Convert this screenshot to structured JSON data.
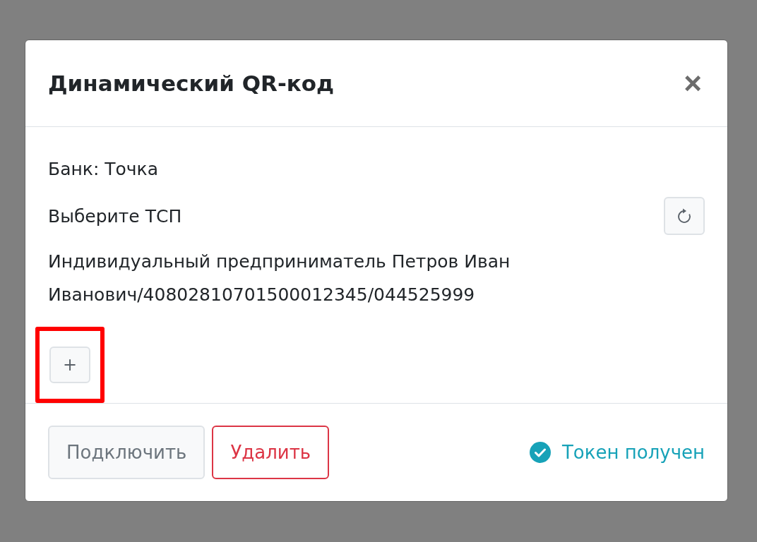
{
  "modal": {
    "title": "Динамический QR-код",
    "close": "×"
  },
  "bank": "Банк: Точка",
  "merchant_label": "Выберите ТСП",
  "merchant": "Индивидуальный предприниматель Петров Иван Иванович/40802810701500012345/044525999",
  "add_button": {
    "label": "+",
    "highlighted": true
  },
  "buttons": [
    {
      "label": "Подключить",
      "kind": "secondary"
    },
    {
      "label": "Удалить",
      "kind": "danger"
    }
  ],
  "status": {
    "text": "Токен получен",
    "kind": "success"
  }
}
